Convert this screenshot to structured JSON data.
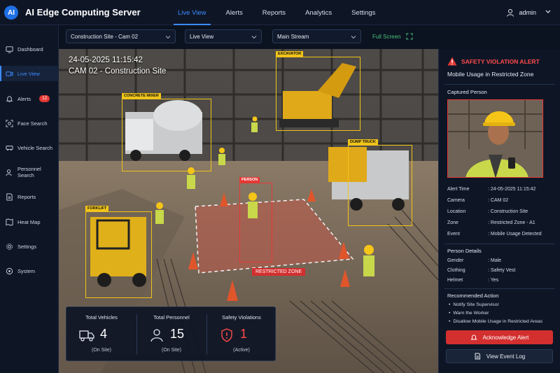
{
  "app": {
    "logo": "AI",
    "title": "AI Edge Computing Server"
  },
  "nav": [
    "Live View",
    "Alerts",
    "Reports",
    "Analytics",
    "Settings"
  ],
  "user": {
    "name": "admin",
    "icon": "user-icon"
  },
  "sidebar": {
    "items": [
      {
        "label": "Dashboard",
        "icon": "dashboard-icon"
      },
      {
        "label": "Live View",
        "icon": "live-view-icon",
        "active": true
      },
      {
        "label": "Alerts",
        "icon": "bell-icon",
        "badge": "12"
      },
      {
        "label": "Face Search",
        "icon": "face-search-icon"
      },
      {
        "label": "Vehicle Search",
        "icon": "vehicle-search-icon"
      },
      {
        "label": "Personnel Search",
        "icon": "personnel-search-icon"
      },
      {
        "label": "Reports",
        "icon": "reports-icon"
      },
      {
        "label": "Heat Map",
        "icon": "heat-map-icon"
      },
      {
        "label": "Settings",
        "icon": "gear-icon"
      },
      {
        "label": "System",
        "icon": "system-icon"
      }
    ]
  },
  "toolbar": {
    "camera_select": "Construction Site - Cam 02",
    "view_select": "Live View",
    "stream_select": "Main Stream",
    "fullscreen": "Full Screen"
  },
  "video": {
    "timestamp": "24-05-2025   11:15:42",
    "camera": "CAM 02 - Construction Site",
    "detections": {
      "excavator": "EXCAVATOR",
      "mixer": "CONCRETE MIXER",
      "dump_truck": "DUMP TRUCK",
      "forklift": "FORKLIFT",
      "person": "PERSON"
    },
    "zone_label": "RESTRICTED ZONE"
  },
  "stats": [
    {
      "title": "Total Vehicles",
      "value": "4",
      "sub": "(On Site)",
      "icon": "truck-icon"
    },
    {
      "title": "Total Personnel",
      "value": "15",
      "sub": "(On Site)",
      "icon": "person-icon"
    },
    {
      "title": "Safety Violations",
      "value": "1",
      "sub": "(Active)",
      "icon": "shield-alert-icon"
    }
  ],
  "alert": {
    "title": "SAFETY VIOLATION ALERT",
    "subtitle": "Mobile Usage in Restricted Zone",
    "captured_title": "Captured Person",
    "details": [
      {
        "key": "Alert Time",
        "value": ": 24-05-2025 11:15:42"
      },
      {
        "key": "Camera",
        "value": ": CAM 02"
      },
      {
        "key": "Location",
        "value": ": Construction Site"
      },
      {
        "key": "Zone",
        "value": ": Restricted Zone - A1"
      },
      {
        "key": "Event",
        "value": ": Mobile Usage Detected"
      }
    ],
    "person_title": "Person Details",
    "person": [
      {
        "key": "Gender",
        "value": ": Male"
      },
      {
        "key": "Clothing",
        "value": ": Safety Vest"
      },
      {
        "key": "Helmet",
        "value": ": Yes"
      }
    ],
    "rec_title": "Recommended Action",
    "recommendations": [
      "Notify Site Supervisor",
      "Warn the Worker",
      "Disallow Mobile Usage in Restricted Areas"
    ],
    "ack_button": "Acknowledge Alert",
    "log_button": "View Event Log"
  },
  "colors": {
    "accent": "#3d8bff",
    "alert": "#e53935",
    "detection": "#f0c419",
    "ok": "#49c27b"
  }
}
